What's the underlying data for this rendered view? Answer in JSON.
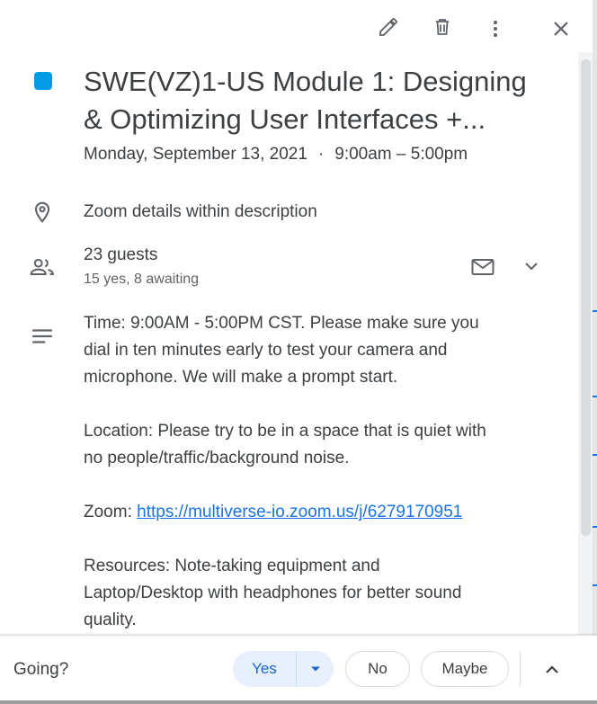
{
  "event": {
    "color": "#039be5",
    "title_line1": "SWE(VZ)1-US Module 1: Designing",
    "title_line2": "& Optimizing User Interfaces +...",
    "date": "Monday, September 13, 2021",
    "separator": "·",
    "time": "9:00am – 5:00pm"
  },
  "toolbar": {
    "edit_icon": "pencil-icon",
    "delete_icon": "trash-icon",
    "more_icon": "more-vert-icon",
    "close_icon": "close-icon"
  },
  "location": {
    "icon": "location-pin-icon",
    "text": "Zoom details within description"
  },
  "guests": {
    "icon": "people-icon",
    "count_label": "23 guests",
    "summary": "15 yes, 8 awaiting",
    "email_icon": "mail-icon",
    "expand_icon": "chevron-down-icon"
  },
  "description": {
    "icon": "notes-icon",
    "lines": [
      "Time: 9:00AM - 5:00PM CST. Please make sure you",
      "dial in ten minutes early to test your camera and",
      "microphone. We will make a prompt start.",
      "",
      "Location: Please try to be in a space that is quiet with",
      "no people/traffic/background noise.",
      "",
      "Resources: Note-taking equipment and",
      "Laptop/Desktop with headphones for better sound",
      "quality."
    ],
    "zoom_prefix": "Zoom: ",
    "zoom_link": "https://multiverse-io.zoom.us/j/6279170951"
  },
  "rsvp": {
    "label": "Going?",
    "yes": "Yes",
    "no": "No",
    "maybe": "Maybe",
    "selected": "Yes",
    "accent": "#1967d2"
  }
}
